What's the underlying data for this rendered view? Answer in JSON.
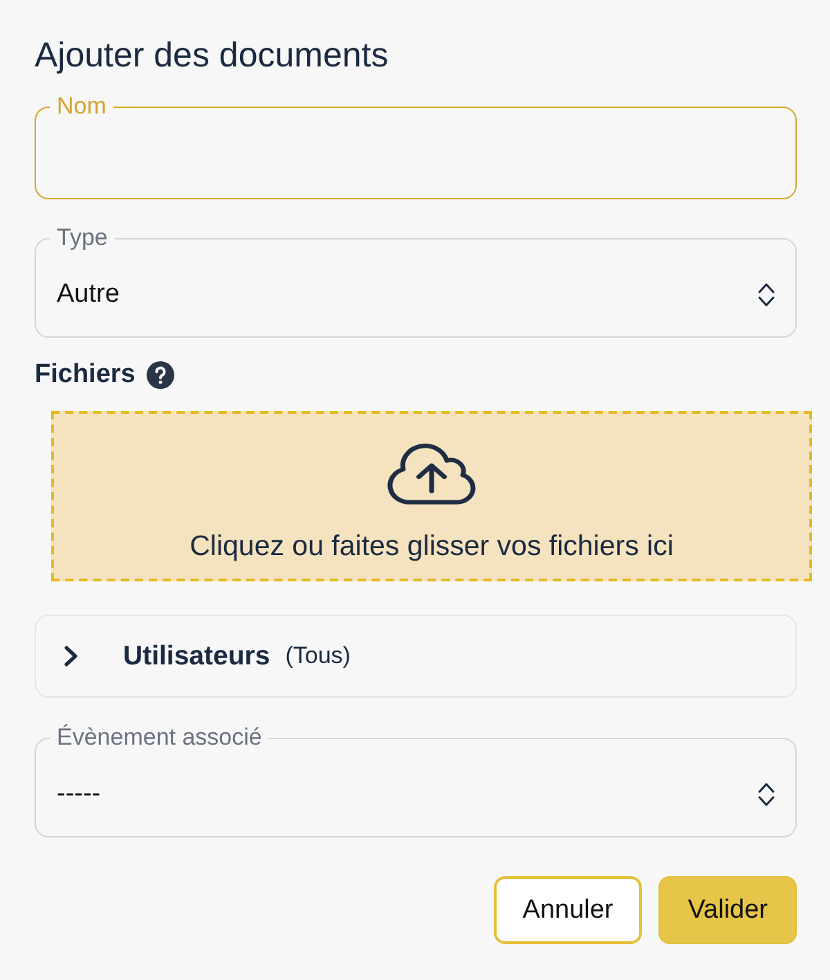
{
  "dialog_title": "Ajouter des documents",
  "name_field": {
    "kind": "text",
    "label": "Nom",
    "focused": true
  },
  "type_field": {
    "kind": "select",
    "label": "Type",
    "value": "Autre",
    "focused": false
  },
  "files": {
    "label": "Fichiers",
    "dropzone_text": "Cliquez ou faites glisser vos fichiers ici"
  },
  "users_section": {
    "title": "Utilisateurs",
    "summary": "(Tous)",
    "expanded": false
  },
  "event_field": {
    "kind": "select",
    "label": "Évènement associé",
    "value": "-----",
    "focused": false
  },
  "buttons": [
    {
      "label": "Annuler",
      "kind": "secondary"
    },
    {
      "label": "Valider",
      "kind": "primary"
    }
  ]
}
